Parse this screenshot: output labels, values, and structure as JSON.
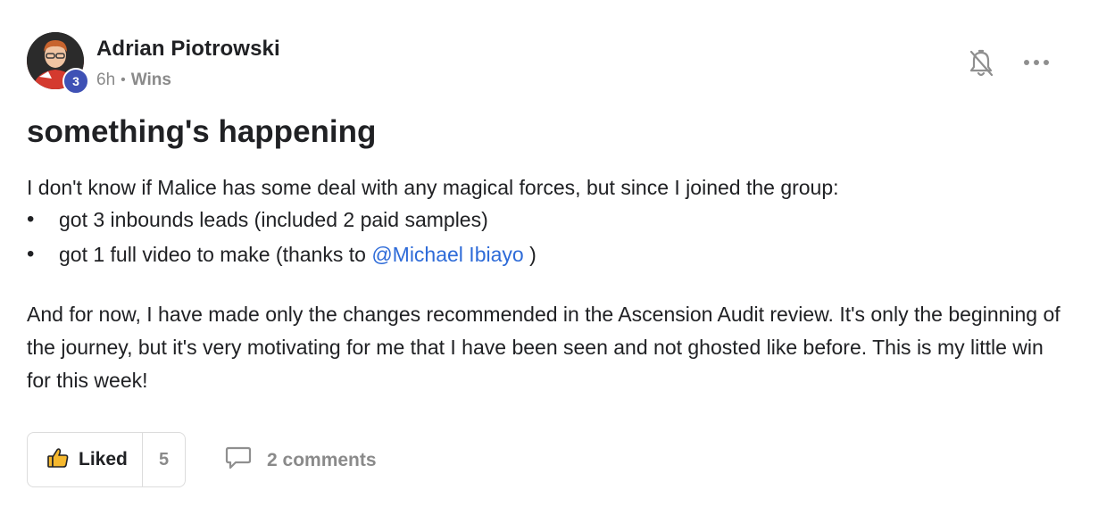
{
  "author": {
    "name": "Adrian Piotrowski",
    "level": "3",
    "time": "6h",
    "separator": "•",
    "category": "Wins"
  },
  "post": {
    "title": "something's happening",
    "intro": "I don't know if Malice has some deal with any magical forces, but since I joined the group:",
    "bullets": {
      "b1": "got 3 inbounds leads (included 2 paid samples)",
      "b2_prefix": "got 1 full video to make (thanks to ",
      "b2_mention": "@Michael Ibiayo",
      "b2_suffix": " )"
    },
    "body": "And for now, I have made only the changes recommended in the Ascension Audit review. It's only the beginning of the journey, but it's very motivating for me that I have been seen and not ghosted like before. This is my little win for this week!"
  },
  "actions": {
    "like_label": "Liked",
    "like_count": "5",
    "comments_label": "2 comments",
    "icons": {
      "like": "thumbs-up-icon",
      "comment": "speech-bubble-icon",
      "bell": "bell-muted-icon",
      "more": "ellipsis-icon"
    }
  },
  "colors": {
    "mention": "#2e6bd8",
    "level_badge": "#3f51b5",
    "like_icon": "#f5b82e",
    "muted_text": "#8a8a8a"
  }
}
